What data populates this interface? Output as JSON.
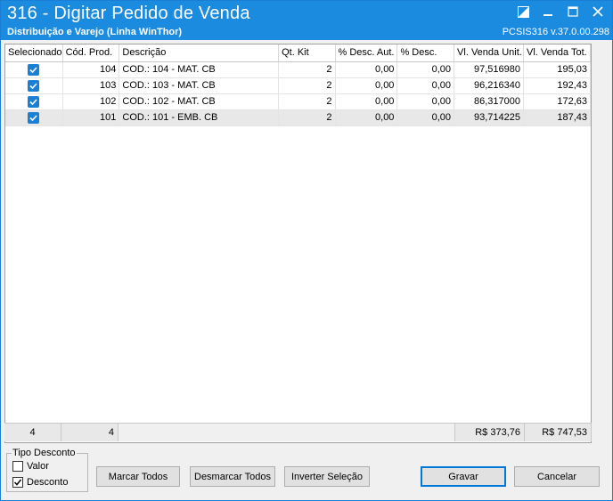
{
  "window": {
    "title": "316 - Digitar Pedido de Venda",
    "subtitle": "Distribuição e Varejo (Linha WinThor)",
    "version": "PCSIS316  v.37.0.00.298"
  },
  "grid": {
    "columns": [
      "Selecionado",
      "Cód. Prod.",
      "Descrição",
      "Qt. Kit",
      "% Desc. Aut.",
      "% Desc.",
      "Vl. Venda Unit.",
      "Vl. Venda Tot."
    ],
    "rows": [
      {
        "selected": true,
        "cod": "104",
        "desc": "COD.: 104 - MAT. CB",
        "qt": "2",
        "descaut": "0,00",
        "desc_pct": "0,00",
        "unit": "97,516980",
        "tot": "195,03"
      },
      {
        "selected": true,
        "cod": "103",
        "desc": "COD.: 103 - MAT. CB",
        "qt": "2",
        "descaut": "0,00",
        "desc_pct": "0,00",
        "unit": "96,216340",
        "tot": "192,43"
      },
      {
        "selected": true,
        "cod": "102",
        "desc": "COD.: 102 - MAT. CB",
        "qt": "2",
        "descaut": "0,00",
        "desc_pct": "0,00",
        "unit": "86,317000",
        "tot": "172,63"
      },
      {
        "selected": true,
        "cod": "101",
        "desc": "COD.: 101 - EMB. CB",
        "qt": "2",
        "descaut": "0,00",
        "desc_pct": "0,00",
        "unit": "93,714225",
        "tot": "187,43"
      }
    ]
  },
  "footer": {
    "count_selected": "4",
    "count_products": "4",
    "unit_total": "R$ 373,76",
    "grand_total": "R$ 747,53"
  },
  "tipo_desconto": {
    "label": "Tipo Desconto",
    "options": [
      {
        "label": "Valor",
        "checked": false
      },
      {
        "label": "Desconto",
        "checked": true
      }
    ]
  },
  "buttons": {
    "marcar": "Marcar Todos",
    "desmarcar": "Desmarcar Todos",
    "inverter": "Inverter Seleção",
    "gravar": "Gravar",
    "cancelar": "Cancelar"
  },
  "icons": {
    "theme": "contrast-icon",
    "minimize": "minimize-icon",
    "maximize": "maximize-icon",
    "close": "close-icon"
  }
}
